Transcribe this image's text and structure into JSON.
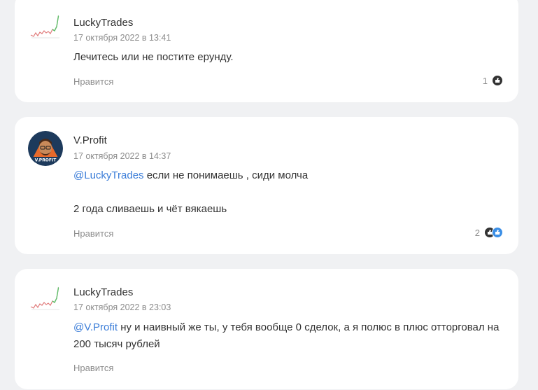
{
  "comments": [
    {
      "author": "LuckyTrades",
      "date": "17 октября 2022 в 13:41",
      "text": "Лечитесь или не постите ерунду.",
      "like_label": "Нравится",
      "reactions_count": "1",
      "avatar_icon": "chart-avatar-icon"
    },
    {
      "author": "V.Profit",
      "date": "17 октября 2022 в 14:37",
      "mention": "@LuckyTrades",
      "text_line1": " если не понимаешь , сиди молча",
      "text_line2": "2 года сливаешь и чёт вякаешь",
      "like_label": "Нравится",
      "reactions_count": "2",
      "avatar_label": "V.PROFIT",
      "avatar_icon": "man-avatar-icon"
    },
    {
      "author": "LuckyTrades",
      "date": "17 октября 2022 в 23:03",
      "mention": "@V.Profit",
      "text": " ну и наивный же ты, у тебя вообще 0 сделок, а я полюс в плюс отторговал на 200 тысяч рублей",
      "like_label": "Нравится",
      "avatar_icon": "chart-avatar-icon"
    }
  ],
  "colors": {
    "background": "#f0f1f3",
    "card": "#ffffff",
    "mention": "#3b7dd8",
    "meta": "#8c8c8c"
  }
}
